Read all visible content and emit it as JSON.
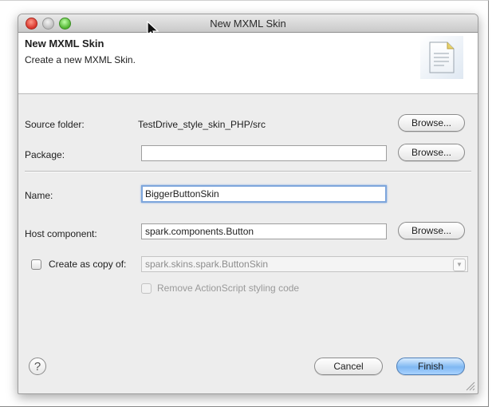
{
  "window": {
    "title": "New MXML Skin"
  },
  "header": {
    "title": "New MXML Skin",
    "description": "Create a new MXML Skin."
  },
  "form": {
    "source_folder": {
      "label": "Source folder:",
      "value": "TestDrive_style_skin_PHP/src",
      "browse_label": "Browse..."
    },
    "package": {
      "label": "Package:",
      "value": "",
      "browse_label": "Browse..."
    },
    "name": {
      "label": "Name:",
      "value": "BiggerButtonSkin"
    },
    "host_component": {
      "label": "Host component:",
      "value": "spark.components.Button",
      "browse_label": "Browse..."
    },
    "create_copy": {
      "label": "Create as copy of:",
      "checked": false,
      "value": "spark.skins.spark.ButtonSkin"
    },
    "remove_actionscript": {
      "label": "Remove ActionScript styling code",
      "checked": false,
      "enabled": false
    }
  },
  "footer": {
    "help_label": "?",
    "cancel_label": "Cancel",
    "finish_label": "Finish"
  },
  "colors": {
    "default_button": "#7fb8f2",
    "focus_ring": "#7ea6dc",
    "close_button": "#d8342a",
    "zoom_button": "#4fb32f"
  },
  "icons": [
    "close-icon",
    "minimize-icon",
    "zoom-icon",
    "document-wizard-icon",
    "help-icon",
    "resize-grip-icon",
    "dropdown-arrow-icon",
    "mouse-cursor-icon"
  ]
}
